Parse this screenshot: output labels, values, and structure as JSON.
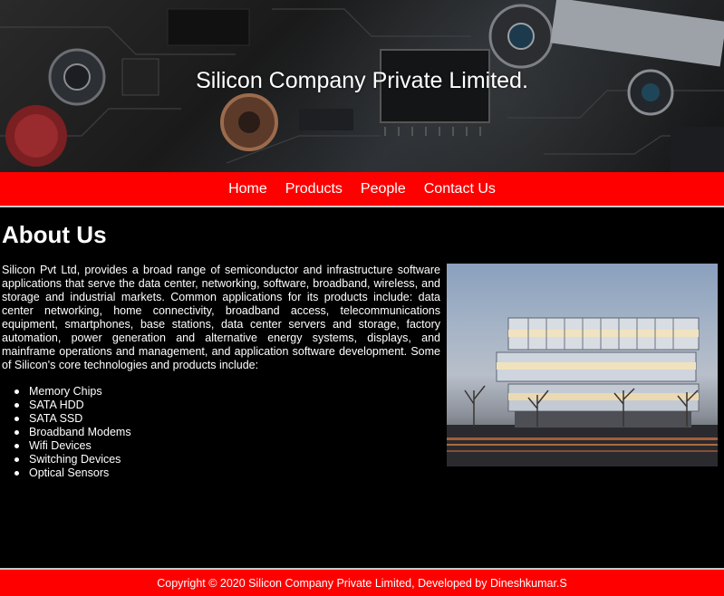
{
  "header": {
    "title": "Silicon Company Private Limited."
  },
  "nav": {
    "items": [
      {
        "label": "Home"
      },
      {
        "label": "Products"
      },
      {
        "label": "People"
      },
      {
        "label": "Contact Us"
      }
    ]
  },
  "main": {
    "heading": "About Us",
    "paragraph": "Silicon Pvt Ltd, provides a broad range of semiconductor and infrastructure software applications that serve the data center, networking, software, broadband, wireless, and storage and industrial markets. Common applications for its products include: data center networking, home connectivity, broadband access, telecommunications equipment, smartphones, base stations, data center servers and storage, factory automation, power generation and alternative energy systems, displays, and mainframe operations and management, and application software development. Some of Silicon's core technologies and products include:",
    "technologies": [
      "Memory Chips",
      "SATA HDD",
      "SATA SSD",
      "Broadband Modems",
      "Wifi Devices",
      "Switching Devices",
      "Optical Sensors"
    ]
  },
  "footer": {
    "text": "Copyright © 2020 Silicon Company Private Limited, Developed by Dineshkumar.S"
  },
  "colors": {
    "accent": "#ff0000",
    "background": "#000000",
    "text": "#ffffff"
  }
}
